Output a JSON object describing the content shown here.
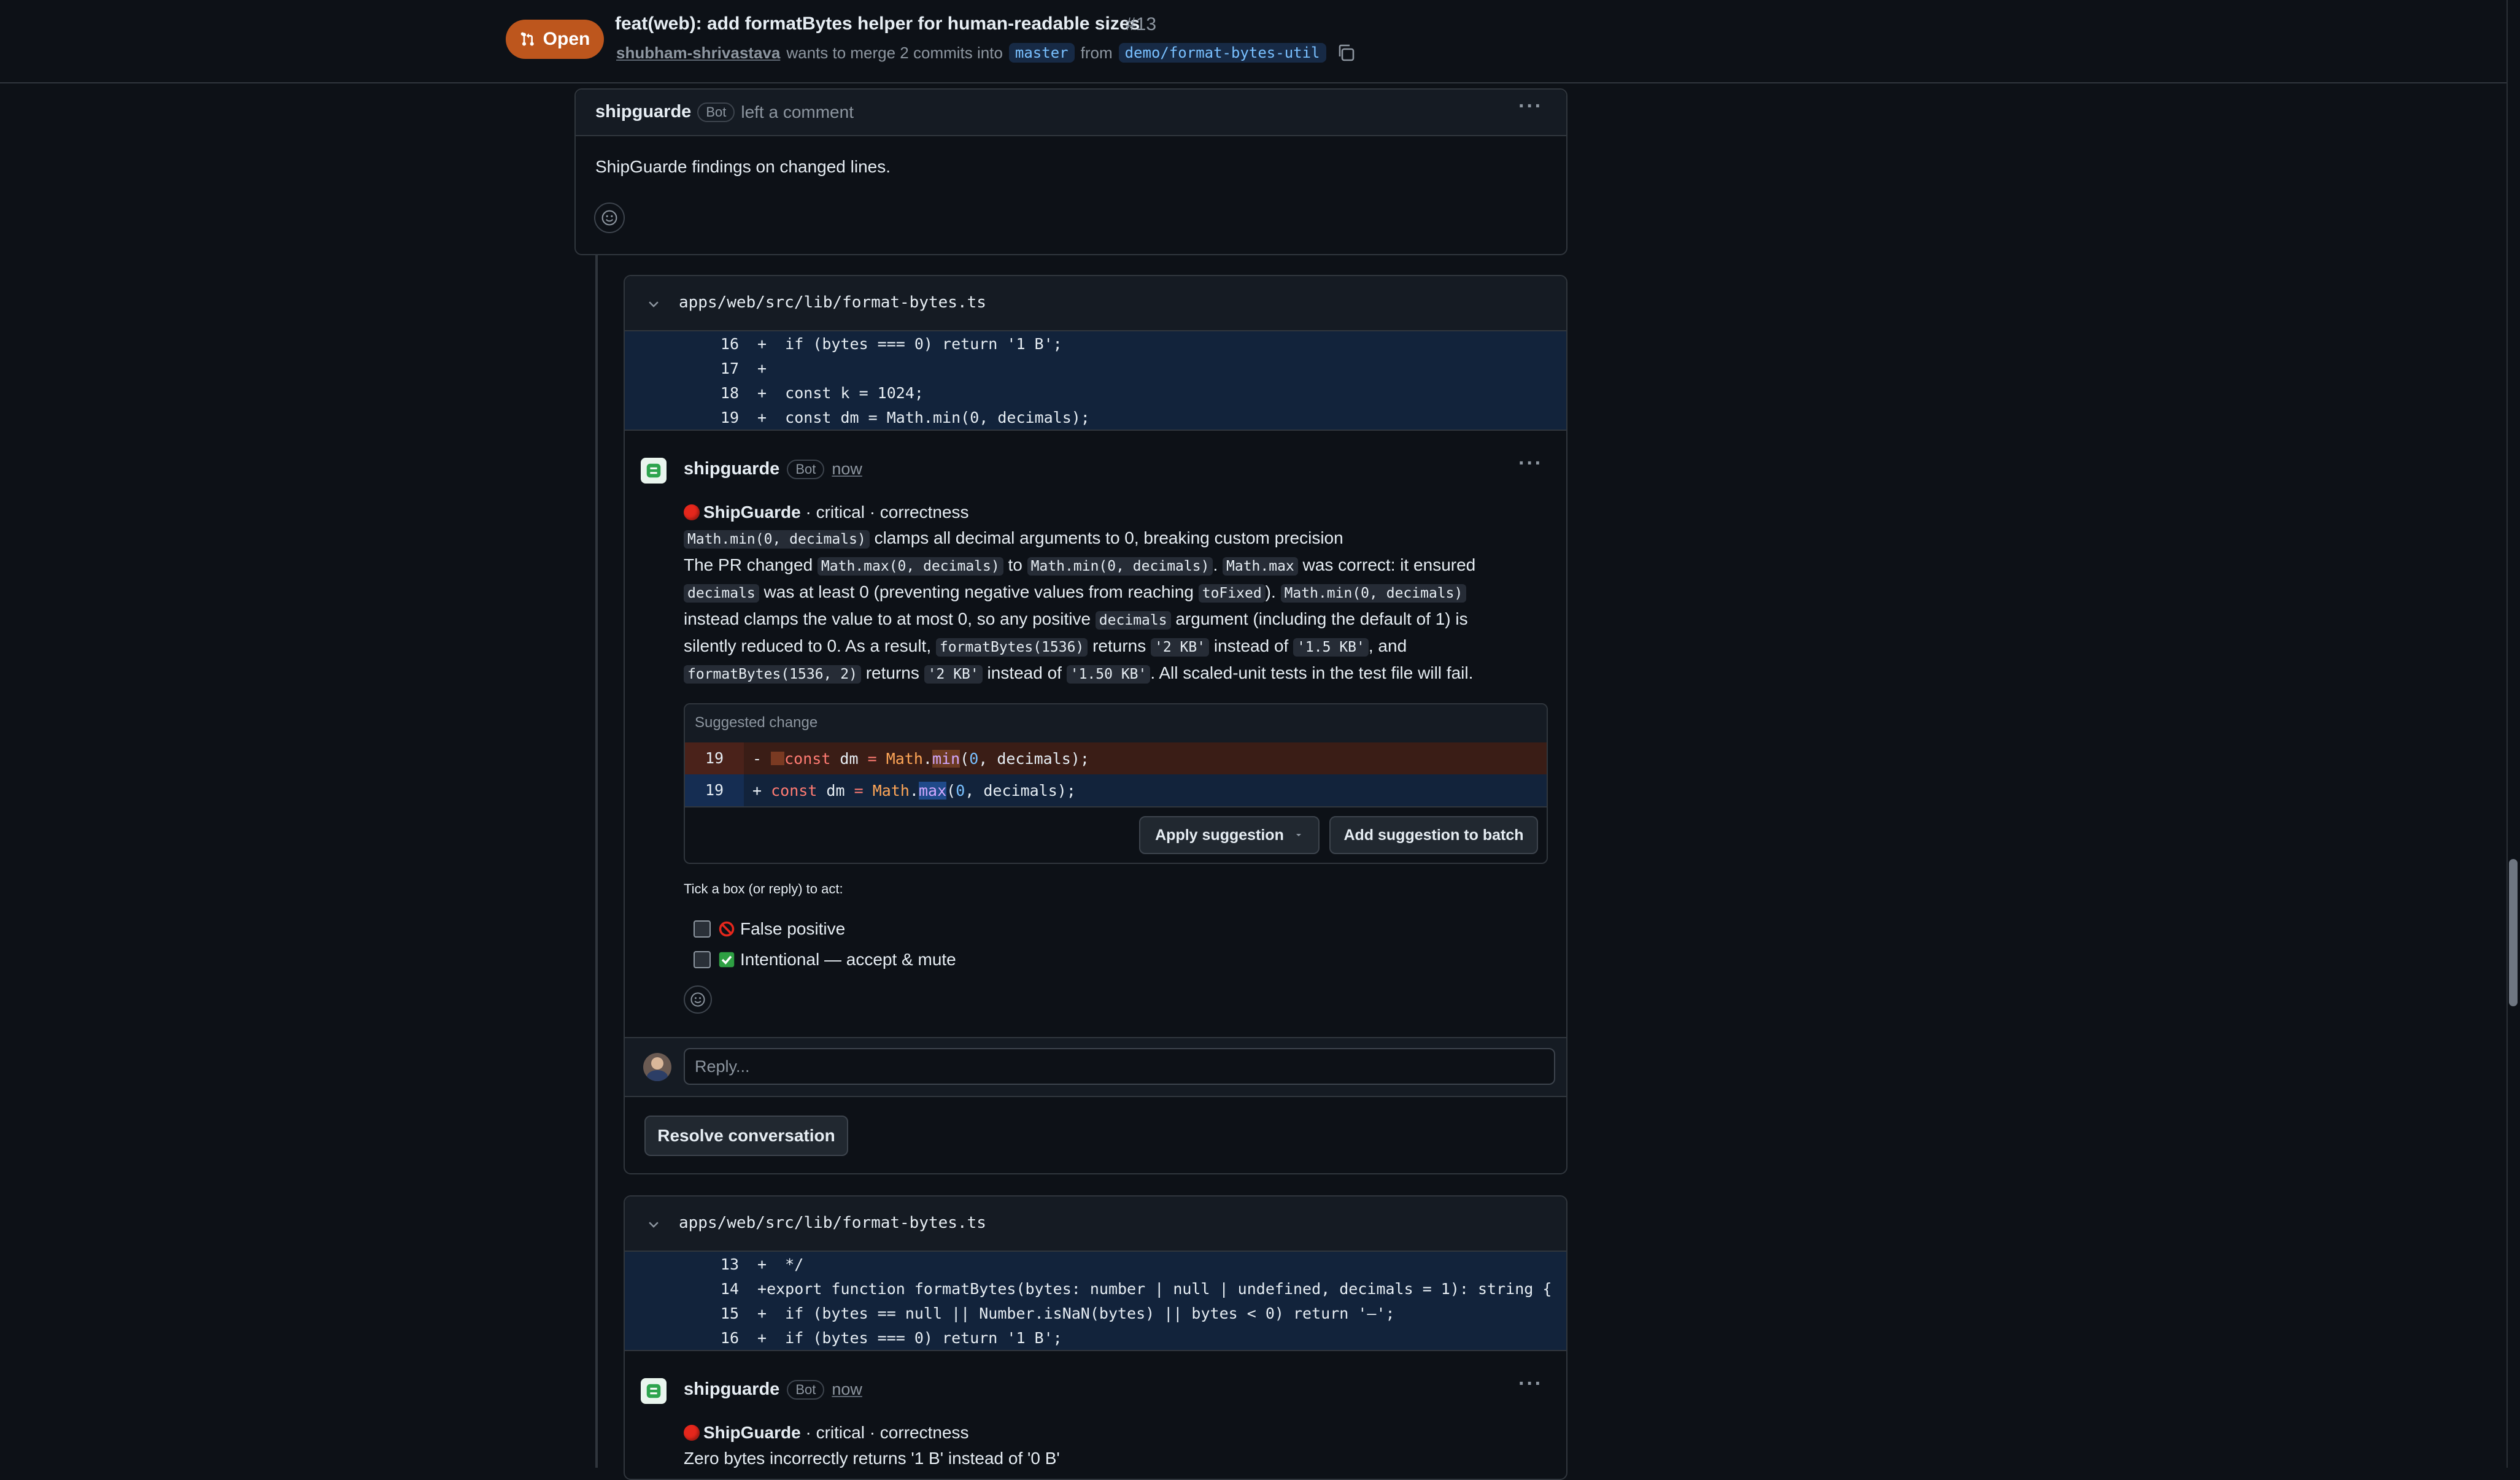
{
  "header": {
    "state": "Open",
    "title": "feat(web): add formatBytes helper for human-readable sizes",
    "number": "#13",
    "author": "shubham-shrivastava",
    "merge_text": "wants to merge 2 commits into",
    "base_branch": "master",
    "from_text": "from",
    "head_branch": "demo/format-bytes-util"
  },
  "top_comment": {
    "author": "shipguarde",
    "badge": "Bot",
    "action": "left a comment",
    "body": "ShipGuarde findings on changed lines."
  },
  "thread1": {
    "file": "apps/web/src/lib/format-bytes.ts",
    "diff": [
      {
        "ln": "16",
        "sign": "+",
        "code": "  if (bytes === 0) return '1 B';"
      },
      {
        "ln": "17",
        "sign": "+",
        "code": ""
      },
      {
        "ln": "18",
        "sign": "+",
        "code": "  const k = 1024;"
      },
      {
        "ln": "19",
        "sign": "+",
        "code": "  const dm = Math.min(0, decimals);"
      }
    ],
    "comment": {
      "author": "shipguarde",
      "badge": "Bot",
      "time": "now",
      "heading_name": "ShipGuarde",
      "heading_rest": " · critical · correctness",
      "title_code": "Math.min(0, decimals)",
      "title_text": " clamps all decimal arguments to 0, breaking custom precision",
      "p1": "The PR changed ",
      "c1": "Math.max(0, decimals)",
      "p2": " to ",
      "c2": "Math.min(0, decimals)",
      "p3": ". ",
      "c3": "Math.max",
      "p4": " was correct: it ensured",
      "c4": "decimals",
      "p5": " was at least 0 (preventing negative values from reaching ",
      "c5": "toFixed",
      "p6": "). ",
      "c6": "Math.min(0, decimals)",
      "p7": "instead clamps the value to at most 0, so any positive ",
      "c7": "decimals",
      "p8": " argument (including the default of 1) is",
      "p9": "silently reduced to 0. As a result, ",
      "c8": "formatBytes(1536)",
      "p10": " returns ",
      "c9": "'2 KB'",
      "p11": " instead of ",
      "c10": "'1.5 KB'",
      "p12": ", and",
      "c11": "formatBytes(1536, 2)",
      "p13": " returns ",
      "c12": "'2 KB'",
      "p14": " instead of ",
      "c13": "'1.50 KB'",
      "p15": ". All scaled-unit tests in the test file will fail.",
      "suggestion": {
        "label": "Suggested change",
        "removed_ln": "19",
        "added_ln": "19",
        "apply": "Apply suggestion",
        "batch": "Add suggestion to batch"
      },
      "tick_label": "Tick a box (or reply) to act:",
      "options": [
        "False positive",
        "Intentional — accept & mute"
      ]
    },
    "reply_placeholder": "Reply...",
    "resolve": "Resolve conversation"
  },
  "thread2": {
    "file": "apps/web/src/lib/format-bytes.ts",
    "diff": [
      {
        "ln": "13",
        "sign": "+",
        "code": "  */"
      },
      {
        "ln": "14",
        "sign": "+",
        "code": "export function formatBytes(bytes: number | null | undefined, decimals = 1): string {"
      },
      {
        "ln": "15",
        "sign": "+",
        "code": "  if (bytes == null || Number.isNaN(bytes) || bytes < 0) return '—';"
      },
      {
        "ln": "16",
        "sign": "+",
        "code": "  if (bytes === 0) return '1 B';"
      }
    ],
    "comment": {
      "author": "shipguarde",
      "badge": "Bot",
      "time": "now",
      "heading_name": "ShipGuarde",
      "heading_rest": " · critical · correctness",
      "title": "Zero bytes incorrectly returns '1 B' instead of '0 B'"
    }
  },
  "colors": {
    "open_badge": "#bd561d",
    "diff_added_bg": "#12233b",
    "suggest_removed_bg": "#3a1d16",
    "critical_dot": "#e5271c"
  }
}
